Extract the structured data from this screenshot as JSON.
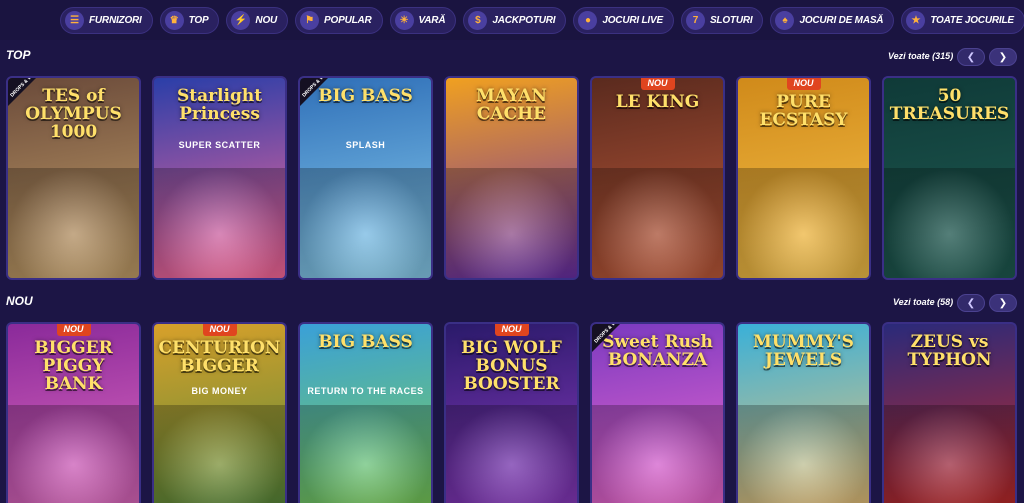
{
  "categories": [
    {
      "label": "FURNIZORI",
      "icon": "providers-icon",
      "glyph": "☰"
    },
    {
      "label": "TOP",
      "icon": "crown-icon",
      "glyph": "♛"
    },
    {
      "label": "NOU",
      "icon": "bolt-icon",
      "glyph": "⚡"
    },
    {
      "label": "POPULAR",
      "icon": "flag-icon",
      "glyph": "⚑"
    },
    {
      "label": "VARĂ",
      "icon": "palm-icon",
      "glyph": "☀"
    },
    {
      "label": "JACKPOTURI",
      "icon": "coins-icon",
      "glyph": "$"
    },
    {
      "label": "JOCURI LIVE",
      "icon": "live-icon",
      "glyph": "●"
    },
    {
      "label": "SLOTURI",
      "icon": "slot-icon",
      "glyph": "7"
    },
    {
      "label": "JOCURI DE MASĂ",
      "icon": "cards-icon",
      "glyph": "♠"
    },
    {
      "label": "TOATE JOCURILE",
      "icon": "star-icon",
      "glyph": "★"
    }
  ],
  "top": {
    "title": "TOP",
    "see_all": "Vezi toate (315)",
    "games": [
      {
        "title": "TES of OLYMPUS 1000",
        "badge": "",
        "drops": "DROPS & WINS",
        "colors": [
          "#6a4a3a",
          "#c7a26b"
        ],
        "sub": ""
      },
      {
        "title": "Starlight Princess",
        "badge": "",
        "drops": "",
        "colors": [
          "#2a3ea8",
          "#ff6a9c"
        ],
        "sub": "SUPER SCATTER"
      },
      {
        "title": "BIG BASS",
        "badge": "",
        "drops": "DROPS & WINS",
        "colors": [
          "#2f6fb8",
          "#8bd0f0"
        ],
        "sub": "SPLASH"
      },
      {
        "title": "MAYAN CACHE",
        "badge": "",
        "drops": "",
        "colors": [
          "#f0a020",
          "#6a2fa8"
        ],
        "sub": ""
      },
      {
        "title": "LE KING",
        "badge": "NOU",
        "drops": "",
        "colors": [
          "#5a2a1e",
          "#c05a3a"
        ],
        "sub": ""
      },
      {
        "title": "PURE ECSTASY",
        "badge": "NOU",
        "drops": "",
        "colors": [
          "#d08a1a",
          "#f7c24a"
        ],
        "sub": ""
      },
      {
        "title": "50 TREASURES",
        "badge": "",
        "drops": "",
        "colors": [
          "#0f3a38",
          "#1f5c52"
        ],
        "sub": ""
      }
    ]
  },
  "new": {
    "title": "NOU",
    "see_all": "Vezi toate (58)",
    "games": [
      {
        "title": "BIGGER PIGGY BANK",
        "badge": "NOU",
        "drops": "",
        "colors": [
          "#8a2a9a",
          "#e06ac0"
        ],
        "sub": ""
      },
      {
        "title": "CENTURION BIGGER",
        "badge": "NOU",
        "drops": "",
        "colors": [
          "#d8a02a",
          "#5a8a3a"
        ],
        "sub": "BIG MONEY"
      },
      {
        "title": "BIG BASS",
        "badge": "",
        "drops": "",
        "colors": [
          "#3aa0d8",
          "#7acd5a"
        ],
        "sub": "RETURN TO THE RACES"
      },
      {
        "title": "BIG WOLF BONUS BOOSTER",
        "badge": "NOU",
        "drops": "",
        "colors": [
          "#2a1a6a",
          "#8a3ac0"
        ],
        "sub": ""
      },
      {
        "title": "Sweet Rush BONANZA",
        "badge": "",
        "drops": "DROPS & WINS",
        "colors": [
          "#7a3ac0",
          "#f06ad0"
        ],
        "sub": ""
      },
      {
        "title": "MUMMY'S JEWELS",
        "badge": "",
        "drops": "",
        "colors": [
          "#3ab0d8",
          "#e8c27a"
        ],
        "sub": ""
      },
      {
        "title": "ZEUS vs TYPHON",
        "badge": "",
        "drops": "",
        "colors": [
          "#2a2a7a",
          "#c02a2a"
        ],
        "sub": ""
      }
    ]
  }
}
